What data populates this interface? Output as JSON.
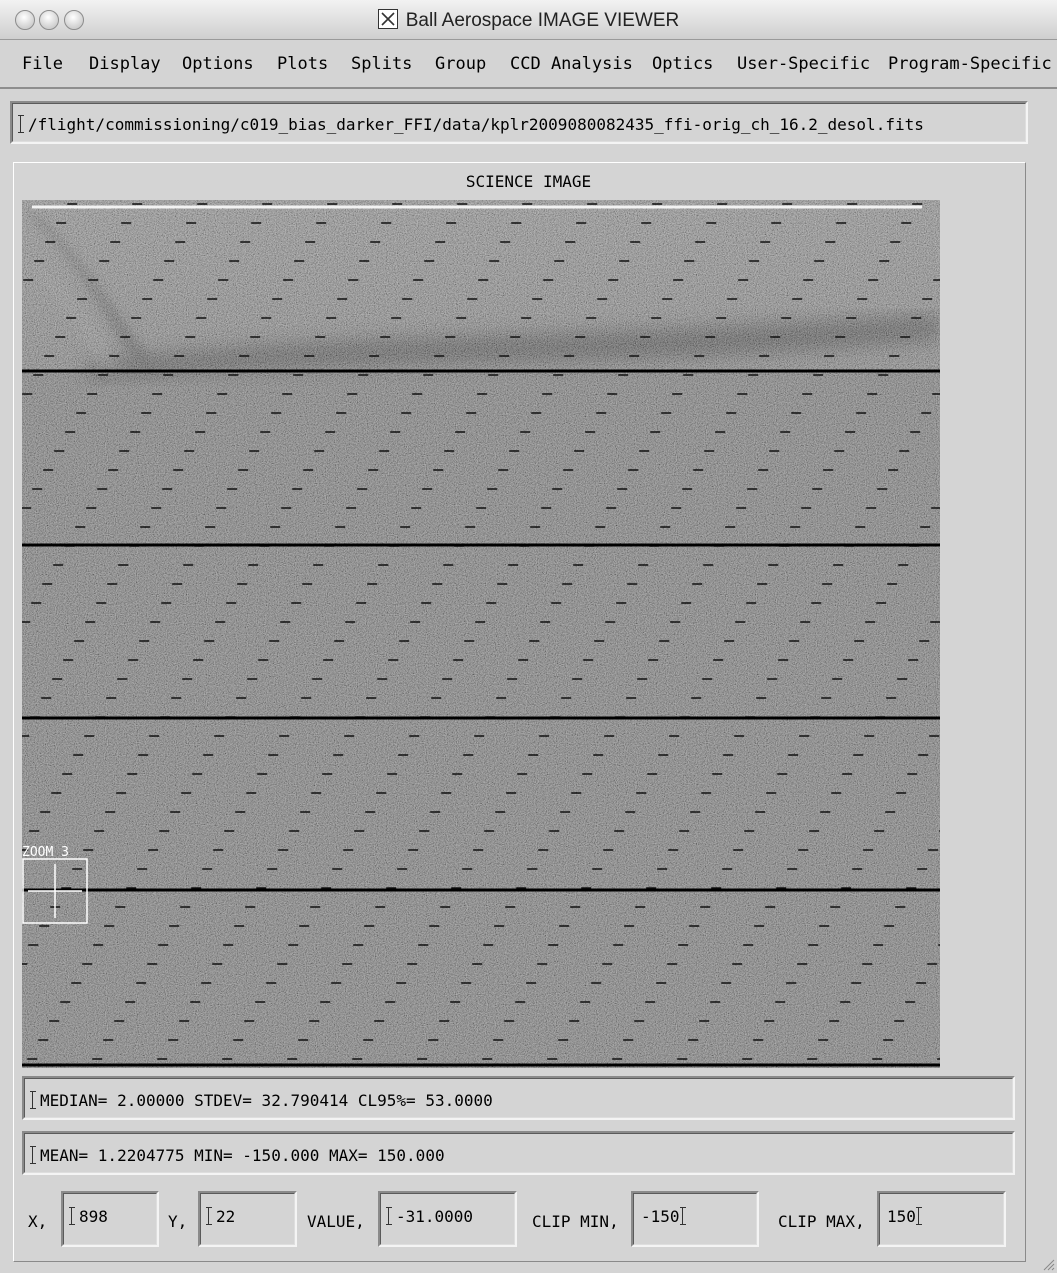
{
  "window": {
    "title": "Ball Aerospace IMAGE VIEWER"
  },
  "menu": [
    "File",
    "Display",
    "Options",
    "Plots",
    "Splits",
    "Group",
    "CCD Analysis",
    "Optics",
    "User-Specific",
    "Program-Specific"
  ],
  "file_path": "/flight/commissioning/c019_bias_darker_FFI/data/kplr2009080082435_ffi-orig_ch_16.2_desol.fits",
  "image_panel": {
    "title": "SCIENCE IMAGE",
    "zoom_label": "ZOOM 3"
  },
  "stats": {
    "line1": "MEDIAN= 2.00000 STDEV= 32.790414 CL95%= 53.0000",
    "line2": "MEAN= 1.2204775 MIN= -150.000 MAX= 150.000"
  },
  "readout": {
    "x_label": "X,",
    "x_value": "898",
    "y_label": "Y,",
    "y_value": "22",
    "value_label": "VALUE,",
    "value_value": "-31.0000",
    "clip_min_label": "CLIP MIN,",
    "clip_min_value": "-150",
    "clip_max_label": "CLIP MAX,",
    "clip_max_value": "150"
  },
  "icons": {
    "x11": "x11-icon",
    "window_buttons": [
      "close-button",
      "minimize-button",
      "zoom-button"
    ],
    "resize": "resize-grip-icon"
  }
}
